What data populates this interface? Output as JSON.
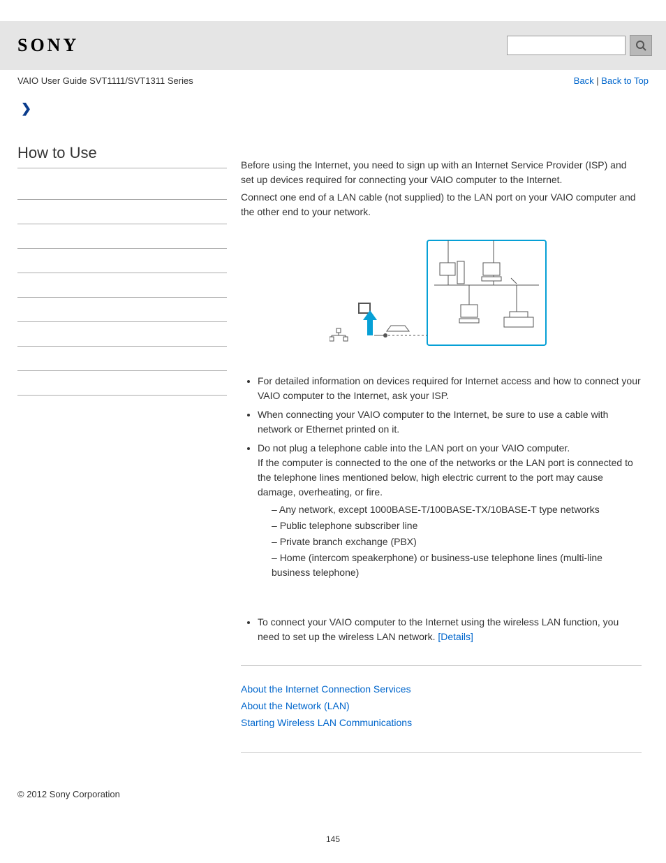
{
  "header": {
    "logo": "SONY",
    "sub_title": "VAIO User Guide SVT1111/SVT1311 Series",
    "nav": {
      "back": "Back",
      "sep": " | ",
      "top": "Back to Top"
    }
  },
  "sidebar": {
    "title": "How to Use",
    "slots": 9
  },
  "main": {
    "p1": "Before using the Internet, you need to sign up with an Internet Service Provider (ISP) and set up devices required for connecting your VAIO computer to the Internet.",
    "p2": "Connect one end of a LAN cable (not supplied) to the LAN port on your VAIO computer and the other end to your network.",
    "bullets": {
      "b1": "For detailed information on devices required for Internet access and how to connect your VAIO computer to the Internet, ask your ISP.",
      "b2": "When connecting your VAIO computer to the Internet, be sure to use a cable with network or Ethernet printed on it.",
      "b3a": "Do not plug a telephone cable into the LAN port on your VAIO computer.",
      "b3b": "If the computer is connected to the one of the networks or the LAN port is connected to the telephone lines mentioned below, high electric current to the port may cause damage, overheating, or fire.",
      "sub": {
        "s1": "Any network, except 1000BASE-T/100BASE-TX/10BASE-T type networks",
        "s2": "Public telephone subscriber line",
        "s3": "Private branch exchange (PBX)",
        "s4": "Home (intercom speakerphone) or business-use telephone lines (multi-line business telephone)"
      },
      "b4a": "To connect your VAIO computer to the Internet using the wireless LAN function, you need to set up the wireless LAN network. ",
      "b4_link": "[Details]"
    },
    "related": {
      "r1": "About the Internet Connection Services",
      "r2": "About the Network (LAN)",
      "r3": "Starting Wireless LAN Communications"
    }
  },
  "footer": {
    "copyright": "© 2012 Sony Corporation",
    "page": "145"
  }
}
